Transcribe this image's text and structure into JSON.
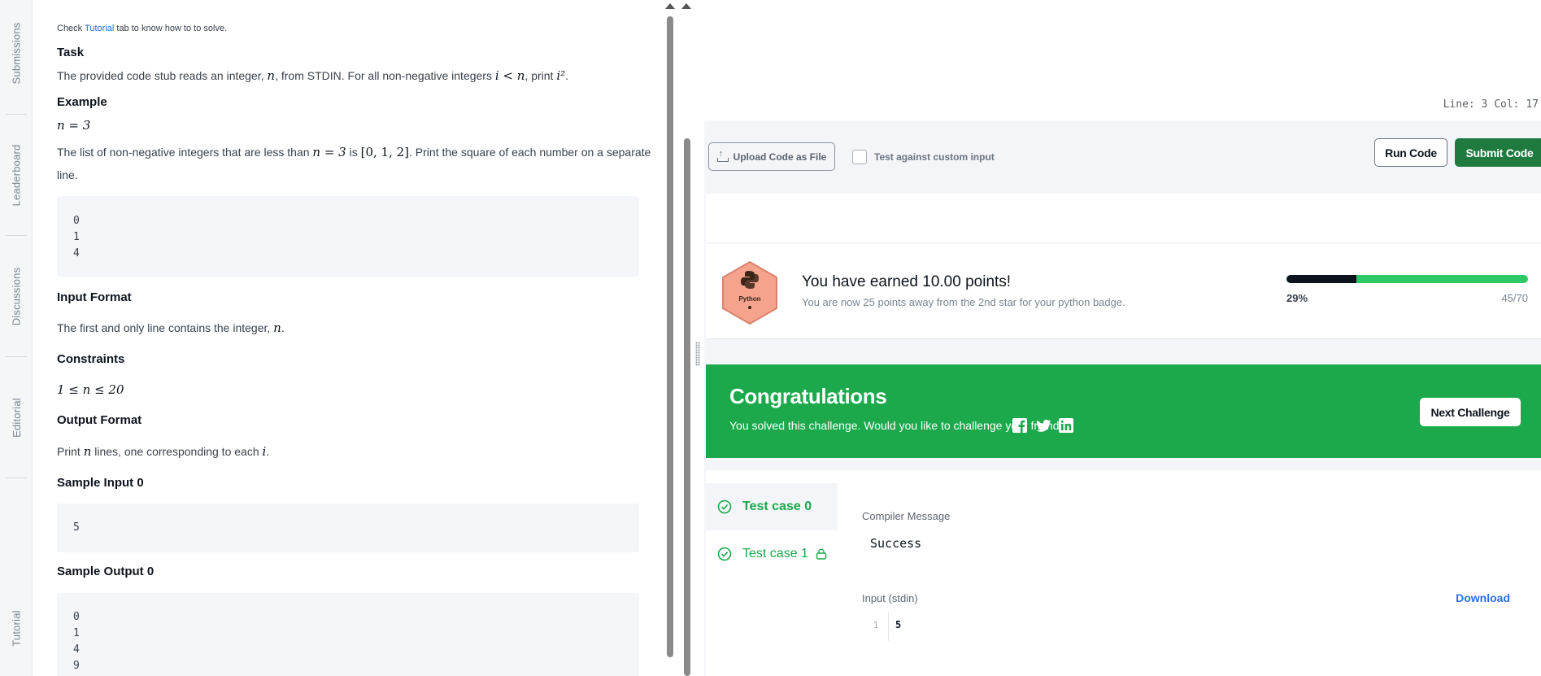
{
  "rail": {
    "tabs": [
      "Submissions",
      "Leaderboard",
      "Discussions",
      "Editorial",
      "Tutorial"
    ]
  },
  "problem": {
    "hint_prefix": "Check ",
    "hint_link": "Tutorial",
    "hint_suffix": " tab to know how to to solve.",
    "task_heading": "Task",
    "task_text_1": "The provided code stub reads an integer, ",
    "task_var_n": "n",
    "task_text_2": ", from STDIN. For all non-negative integers ",
    "task_cond": "i < n",
    "task_text_3": ", print ",
    "task_expr": "i²",
    "task_text_4": ".",
    "example_heading": "Example",
    "example_value": "n = 3",
    "example_text_1": "The list of non-negative integers that are less than ",
    "example_text_cond": "n = 3",
    "example_text_2": " is ",
    "example_list": "[0, 1, 2]",
    "example_text_3": ". Print the square of each number on a separate",
    "example_text_4": "line.",
    "example_output": [
      "0",
      "1",
      "4"
    ],
    "input_heading": "Input Format",
    "input_text": "The first and only line contains the integer, ",
    "input_var": "n",
    "input_end": ".",
    "constraints_heading": "Constraints",
    "constraints_text": "1 ≤ n ≤ 20",
    "output_heading": "Output Format",
    "output_text_1": "Print ",
    "output_var_n": "n",
    "output_text_2": " lines, one corresponding to each ",
    "output_var_i": "i",
    "output_text_3": ".",
    "sample_input_heading": "Sample Input 0",
    "sample_input": [
      "5"
    ],
    "sample_output_heading": "Sample Output 0",
    "sample_output": [
      "0",
      "1",
      "4",
      "9"
    ]
  },
  "editor": {
    "cursor_status": "Line: 3 Col: 17"
  },
  "toolbar": {
    "upload_label": "Upload Code as File",
    "custom_input_label": "Test against custom input",
    "run_label": "Run Code",
    "submit_label": "Submit Code"
  },
  "points": {
    "badge_name": "Python",
    "earned_text": "You have earned 10.00 points!",
    "away_text": "You are now 25 points away from the 2nd star for your python badge.",
    "progress_percent_label": "29%",
    "progress_fraction": 0.29,
    "progress_ratio": "45/70"
  },
  "congrats": {
    "title": "Congratulations",
    "subtitle": "You solved this challenge. Would you like to challenge your friends?",
    "next_label": "Next Challenge"
  },
  "results": {
    "tests": [
      "Test case 0",
      "Test case 1"
    ],
    "compiler_label": "Compiler Message",
    "compiler_message": "Success",
    "stdin_label": "Input (stdin)",
    "download_label": "Download",
    "stdin_line_number": "1",
    "stdin_value": "5"
  },
  "colors": {
    "success_green": "#1ba94c",
    "submit_green": "#1e7a3f",
    "progress_dark": "#0e141e",
    "progress_green": "#2ec866",
    "badge_salmon": "#f5a38c",
    "link_blue": "#2a6ee8"
  }
}
